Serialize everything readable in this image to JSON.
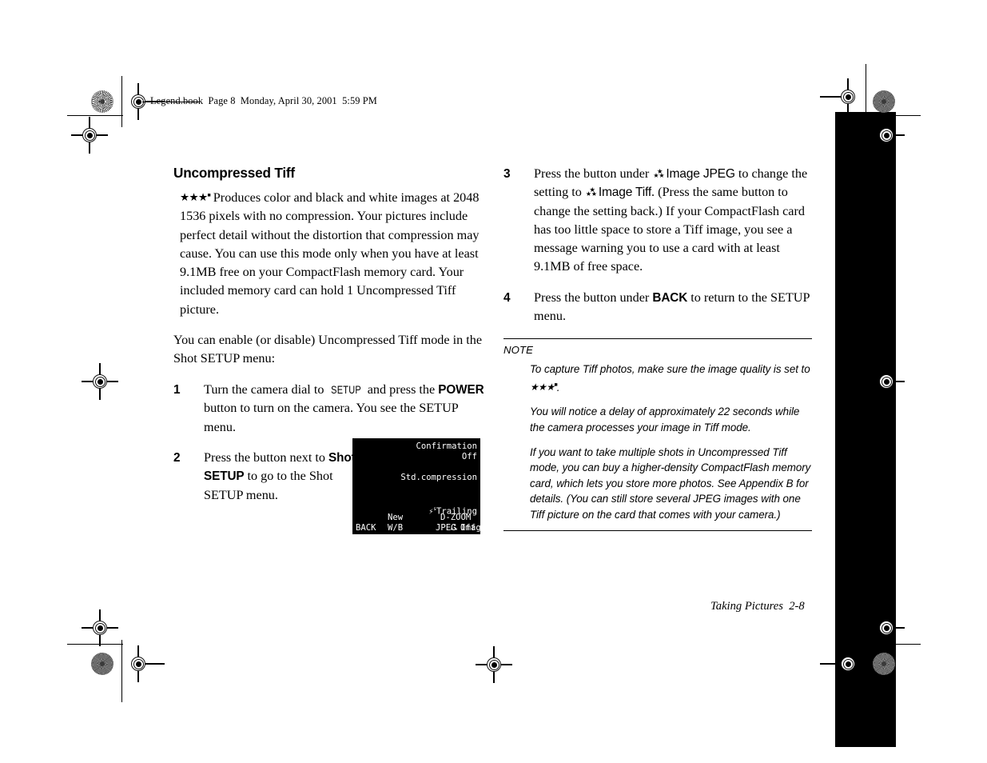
{
  "running_header": "Legend.book  Page 8  Monday, April 30, 2001  5:59 PM",
  "left_column": {
    "section_title": "Uncompressed Tiff",
    "intro_stars": "★★★",
    "intro_paragraph": "Produces color and black and white images at 2048    1536 pixels with no compression. Your pictures include perfect detail without the distortion that compression may cause. You can use this mode only when you have at least 9.1MB free on your CompactFlash memory card. Your included memory card can hold 1 Uncompressed Tiff picture.",
    "enable_paragraph": "You can enable (or disable) Uncompressed Tiff mode in the Shot SETUP menu:",
    "steps": [
      {
        "num": "1",
        "part1": "Turn the camera dial to ",
        "lcd_word": "SETUP",
        "part2": " and press the ",
        "ui_word": "POWER",
        "part3": " button to turn on the camera. You see the SETUP menu."
      },
      {
        "num": "2",
        "part1": "Press the button next to ",
        "ui_word": "Shot SETUP",
        "part2": " to go to the Shot SETUP menu."
      }
    ]
  },
  "lcd_screen": {
    "confirmation_label": "Confirmation",
    "confirmation_value": "Off",
    "compression": "Std.compression",
    "flash_mode": "Trailing",
    "flash_icon": "flash-trailing-icon",
    "back_label": "BACK",
    "wb_top": "New",
    "wb_bottom": "W/B",
    "image_top": "Image",
    "image_bottom": "JPEG",
    "image_icon": "quality-stars-icon",
    "dzoom_top": "D-ZOOM",
    "dzoom_bottom": "Off"
  },
  "right_column": {
    "steps": [
      {
        "num": "3",
        "part1": "Press the button under ",
        "ui_word1": "Image JPEG",
        "part2": " to change the setting to ",
        "ui_word2": "Image Tiff",
        "part3": ". (Press the same button to change the setting back.) If your CompactFlash card has too little space to store a Tiff image, you see a message warning you to use a card with at least 9.1MB of free space."
      },
      {
        "num": "4",
        "part1": "Press the button under ",
        "ui_word": "BACK",
        "part2": " to return to the SETUP menu."
      }
    ]
  },
  "note": {
    "label": "NOTE",
    "paragraphs": [
      {
        "before": "To capture Tiff photos, make sure the image quality is set to ",
        "stars": "★★★",
        "after": "."
      },
      {
        "before": "You will notice a delay of approximately 22 seconds while the camera processes your image in Tiff mode.",
        "stars": "",
        "after": ""
      },
      {
        "before": "If you want to take multiple shots in Uncompressed Tiff mode, you can buy a higher-density CompactFlash memory card, which lets you store more photos. See Appendix B for details. (You can still store several JPEG images with one Tiff picture on the card that comes with your camera.)",
        "stars": "",
        "after": ""
      }
    ]
  },
  "footer": {
    "folio": "Taking Pictures  2-8"
  },
  "colors": {
    "page_background": "#ffffff",
    "text": "#000000",
    "thumb_tab": "#000000",
    "lcd_background": "#000000",
    "lcd_text": "#ffffff"
  }
}
